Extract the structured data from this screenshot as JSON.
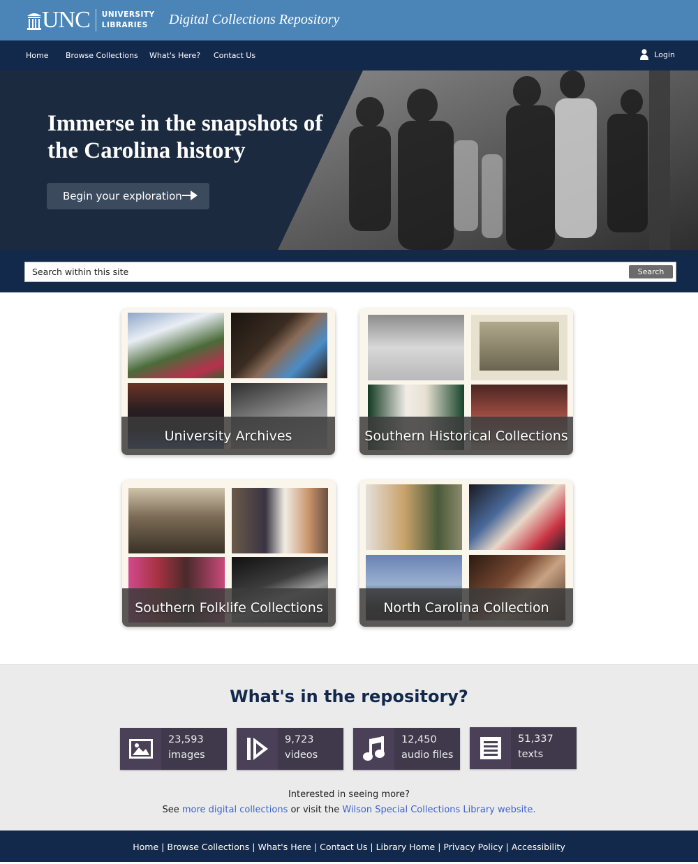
{
  "header": {
    "logo_text": "UNC",
    "logo_sub_line1": "UNIVERSITY",
    "logo_sub_line2": "LIBRARIES",
    "site_title": "Digital Collections Repository"
  },
  "nav": {
    "items": [
      "Home",
      "Browse Collections",
      "What's Here?",
      "Contact Us"
    ],
    "login": "Login"
  },
  "hero": {
    "title": "Immerse in the snapshots of the Carolina history",
    "button_label": "Begin your exploration"
  },
  "search": {
    "placeholder": "Search within this site",
    "button_label": "Search"
  },
  "collections": [
    {
      "label": "University Archives"
    },
    {
      "label": "Southern Historical Collections"
    },
    {
      "label": "Southern Folklife Collections"
    },
    {
      "label": "North Carolina Collection"
    }
  ],
  "stats": {
    "title": "What's in the repository?",
    "items": [
      {
        "count": "23,593",
        "label": "images",
        "icon": "image-icon"
      },
      {
        "count": "9,723",
        "label": "videos",
        "icon": "video-play-icon"
      },
      {
        "count": "12,450",
        "label": "audio files",
        "icon": "music-note-icon"
      },
      {
        "count": "51,337",
        "label": "texts",
        "icon": "text-document-icon"
      }
    ],
    "more_line1": "Interested in seeing more?",
    "more_prefix": "See",
    "more_link1": "more digital collections",
    "more_middle": "or visit the",
    "more_link2": "Wilson Special Collections Library website."
  },
  "footer": {
    "links": [
      "Home",
      "Browse Collections",
      "What's Here",
      "Contact Us",
      "Library Home",
      "Privacy Policy",
      "Accessibility"
    ]
  },
  "colors": {
    "masthead": "#4b85b8",
    "navy": "#13294b",
    "stat_tile": "#4a4158",
    "link": "#3f63c8"
  }
}
